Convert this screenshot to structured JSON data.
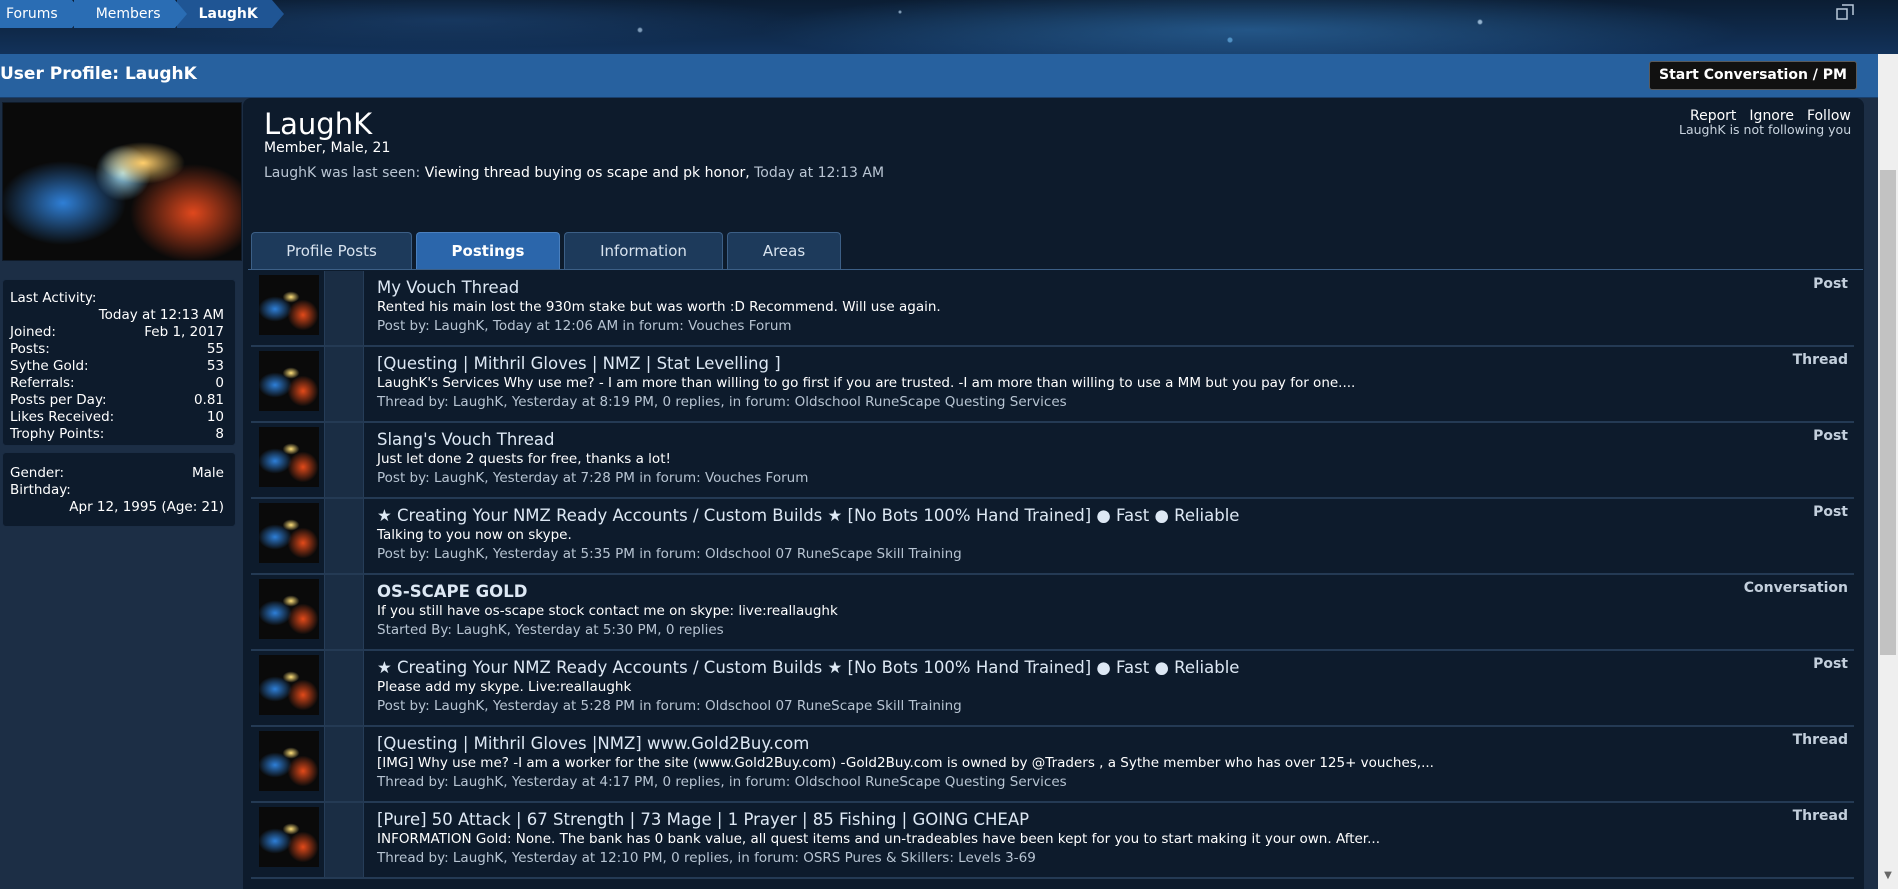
{
  "breadcrumb": [
    "Forums",
    "Members",
    "LaughK"
  ],
  "page_title": "User Profile: LaughK",
  "start_pm_label": "Start Conversation / PM",
  "window_icon": "maximize-icon",
  "sidebar": {
    "stats": [
      {
        "label": "Last Activity:",
        "value": "Today at 12:13 AM"
      },
      {
        "label": "Joined:",
        "value": "Feb 1, 2017"
      },
      {
        "label": "Posts:",
        "value": "55"
      },
      {
        "label": "Sythe Gold:",
        "value": "53"
      },
      {
        "label": "Referrals:",
        "value": "0"
      },
      {
        "label": "Posts per Day:",
        "value": "0.81"
      },
      {
        "label": "Likes Received:",
        "value": "10"
      },
      {
        "label": "Trophy Points:",
        "value": "8"
      }
    ],
    "info": [
      {
        "label": "Gender:",
        "value": "Male"
      },
      {
        "label": "Birthday:",
        "value": "Apr 12, 1995 (Age: 21)"
      }
    ]
  },
  "profile": {
    "username": "LaughK",
    "user_title": "Member, Male, 21",
    "last_seen_prefix": "LaughK was last seen:",
    "last_seen_action": "Viewing thread",
    "last_seen_thread": "buying os scape and pk honor,",
    "last_seen_time": "Today at 12:13 AM",
    "actions": [
      "Report",
      "Ignore",
      "Follow"
    ],
    "follow_note": "LaughK is not following you"
  },
  "tabs": [
    "Profile Posts",
    "Postings",
    "Information",
    "Areas"
  ],
  "active_tab": "Postings",
  "postings": [
    {
      "title": "My Vouch Thread",
      "snippet": "Rented his main lost the 930m stake but was worth :D Recommend. Will use again.",
      "meta": "Post by: LaughK, Today at 12:06 AM in forum: Vouches Forum",
      "type": "Post"
    },
    {
      "title": "[Questing | Mithril Gloves | NMZ | Stat Levelling ]",
      "snippet": "LaughK's Services Why use me? - I am more than willing to go first if you are trusted. -I am more than willing to use a MM but you pay for one....",
      "meta": "Thread by: LaughK, Yesterday at 8:19 PM, 0 replies, in forum: Oldschool RuneScape Questing Services",
      "type": "Thread"
    },
    {
      "title": "Slang's Vouch Thread",
      "snippet": "Just let done 2 quests for free, thanks a lot!",
      "meta": "Post by: LaughK, Yesterday at 7:28 PM in forum: Vouches Forum",
      "type": "Post"
    },
    {
      "title": "★ Creating Your NMZ Ready Accounts / Custom Builds ★ [No Bots 100% Hand Trained] ● Fast ● Reliable",
      "snippet": "Talking to you now on skype.",
      "meta": "Post by: LaughK, Yesterday at 5:35 PM in forum: Oldschool 07 RuneScape Skill Training",
      "type": "Post"
    },
    {
      "title": "OS-SCAPE GOLD",
      "snippet": "If you still have os-scape stock contact me on skype: live:reallaughk",
      "meta": "Started By: LaughK, Yesterday at 5:30 PM, 0 replies",
      "type": "Conversation",
      "bold": true
    },
    {
      "title": "★ Creating Your NMZ Ready Accounts / Custom Builds ★ [No Bots 100% Hand Trained] ● Fast ● Reliable",
      "snippet": "Please add my skype. Live:reallaughk",
      "meta": "Post by: LaughK, Yesterday at 5:28 PM in forum: Oldschool 07 RuneScape Skill Training",
      "type": "Post"
    },
    {
      "title": "[Questing | Mithril Gloves |NMZ] www.Gold2Buy.com",
      "snippet": "[IMG] Why use me? -I am a worker for the site (www.Gold2Buy.com) -Gold2Buy.com is owned by @Traders , a Sythe member who has over 125+ vouches,...",
      "meta": "Thread by: LaughK, Yesterday at 4:17 PM, 0 replies, in forum: Oldschool RuneScape Questing Services",
      "type": "Thread"
    },
    {
      "title": "[Pure] 50 Attack | 67 Strength | 73 Mage | 1 Prayer | 85 Fishing | GOING CHEAP",
      "snippet": "INFORMATION Gold: None. The bank has 0 bank value, all quest items and un-tradeables have been kept for you to start making it your own. After...",
      "meta": "Thread by: LaughK, Yesterday at 12:10 PM, 0 replies, in forum: OSRS Pures & Skillers: Levels 3-69",
      "type": "Thread"
    }
  ]
}
